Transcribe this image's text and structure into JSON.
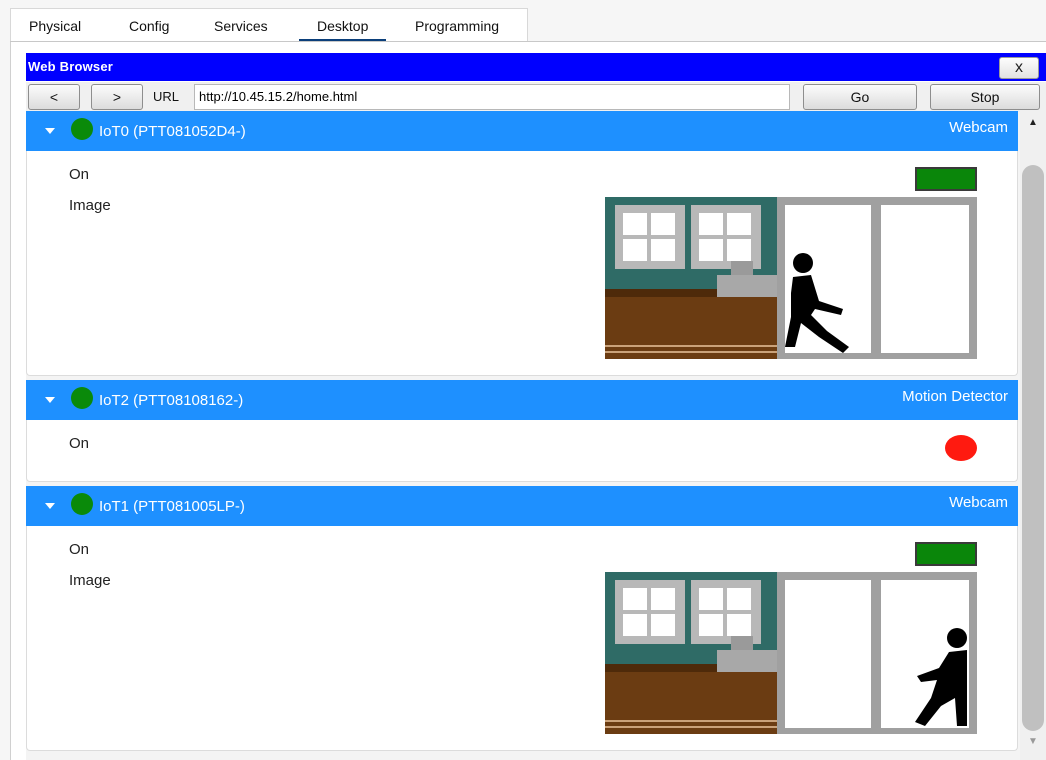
{
  "tabs": [
    {
      "label": "Physical"
    },
    {
      "label": "Config"
    },
    {
      "label": "Services"
    },
    {
      "label": "Desktop",
      "active": true
    },
    {
      "label": "Programming"
    }
  ],
  "browser": {
    "title": "Web Browser",
    "close_label": "x",
    "back_label": "<",
    "forward_label": ">",
    "url_label": "URL",
    "url_value": "http://10.45.15.2/home.html",
    "go_label": "Go",
    "stop_label": "Stop"
  },
  "devices": [
    {
      "name": "IoT0 (PTT081052D4-)",
      "type": "Webcam",
      "status_color": "#0a8a0a",
      "rows": [
        {
          "label": "On",
          "state": "on"
        },
        {
          "label": "Image"
        }
      ],
      "person_position": "entering"
    },
    {
      "name": "IoT2 (PTT08108162-)",
      "type": "Motion Detector",
      "status_color": "#0a8a0a",
      "rows": [
        {
          "label": "On",
          "state": "off"
        }
      ]
    },
    {
      "name": "IoT1 (PTT081005LP-)",
      "type": "Webcam",
      "status_color": "#0a8a0a",
      "rows": [
        {
          "label": "On",
          "state": "on"
        },
        {
          "label": "Image"
        }
      ],
      "person_position": "exiting"
    }
  ],
  "colors": {
    "header_blue": "#1e90ff",
    "title_blue": "#0000ff",
    "on_green": "#0a860a",
    "off_red": "#ff1a10"
  },
  "icons": [
    "chevron-down-icon",
    "status-dot-icon",
    "close-icon",
    "scroll-up-icon",
    "scroll-down-icon"
  ]
}
